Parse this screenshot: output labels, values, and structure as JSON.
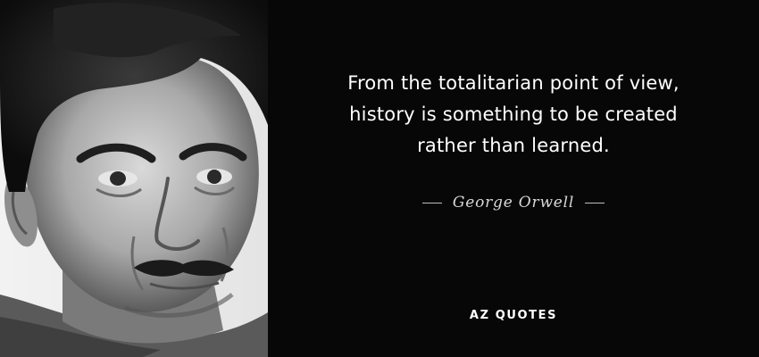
{
  "quote": {
    "lines": [
      "From the totalitarian point of view,",
      "history is something to be created",
      "rather than learned."
    ]
  },
  "author": {
    "name": "George Orwell"
  },
  "brand": {
    "name": "AZ QUOTES"
  },
  "colors": {
    "background": "#070707",
    "text": "#ffffff",
    "author_text": "#d8d8d8"
  }
}
